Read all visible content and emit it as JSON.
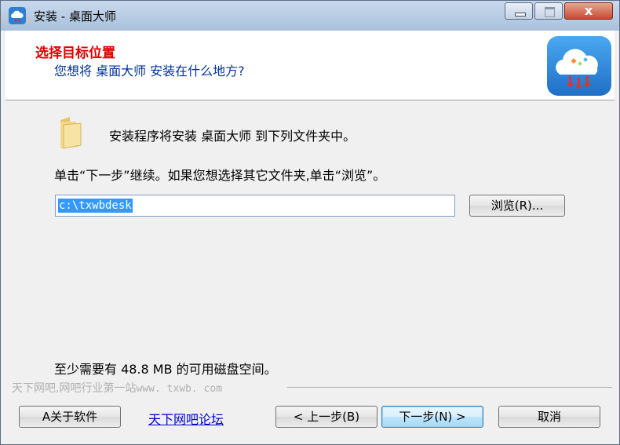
{
  "window": {
    "title": "安装 - 桌面大师",
    "close_glyph": "x"
  },
  "header": {
    "title": "选择目标位置",
    "subtitle": "您想将 桌面大师 安装在什么地方?"
  },
  "content": {
    "install_message": "安装程序将安装 桌面大师 到下列文件夹中。",
    "continue_message": "单击“下一步”继续。如果您想选择其它文件夹,单击“浏览”。",
    "path_value": "c:\\txwbdesk",
    "browse_label": "浏览(R)...",
    "disk_space": "至少需要有 48.8 MB 的可用磁盘空间。"
  },
  "footer": {
    "watermark": "天下网吧,网吧行业第一站",
    "watermark_url": "www. txwb. com",
    "about_label": "A关于软件",
    "forum_link": "天下网吧论坛",
    "back_label": "< 上一步(B)",
    "next_label": "下一步(N) >",
    "cancel_label": "取消"
  },
  "colors": {
    "header_title": "#e00000",
    "header_subtitle": "#003399",
    "link": "#0000cc",
    "selection": "#3399ff"
  },
  "icons": {
    "app": "cloud-download-icon",
    "folder": "folder-icon",
    "logo": "cloud-download-logo"
  }
}
